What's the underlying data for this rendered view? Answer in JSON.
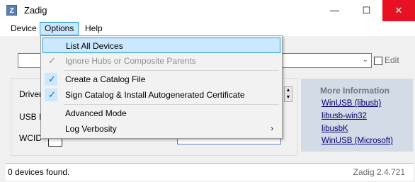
{
  "window": {
    "title": "Zadig",
    "icon_glyph": "Z",
    "minimize": "—",
    "maximize": "☐",
    "close": "✕"
  },
  "menubar": {
    "device": "Device",
    "options": "Options",
    "help": "Help"
  },
  "options_menu": {
    "list_all_devices": "List All Devices",
    "ignore_hubs": "Ignore Hubs or Composite Parents",
    "create_catalog": "Create a Catalog File",
    "sign_catalog": "Sign Catalog & Install Autogenerated Certificate",
    "advanced_mode": "Advanced Mode",
    "log_verbosity": "Log Verbosity",
    "check_glyph": "✓",
    "submenu_arrow": "›"
  },
  "main": {
    "combo_arrow": "⌄",
    "edit_label": "Edit",
    "driver_label": "Driver",
    "usb_id_label": "USB ID",
    "wcid_label": "WCID",
    "field_arrow": "▾"
  },
  "more_info": {
    "title": "More Information",
    "links": [
      "WinUSB (libusb)",
      "libusb-win32",
      "libusbK",
      "WinUSB (Microsoft)"
    ]
  },
  "status": {
    "text": "0 devices found.",
    "version": "Zadig 2.4.721"
  }
}
